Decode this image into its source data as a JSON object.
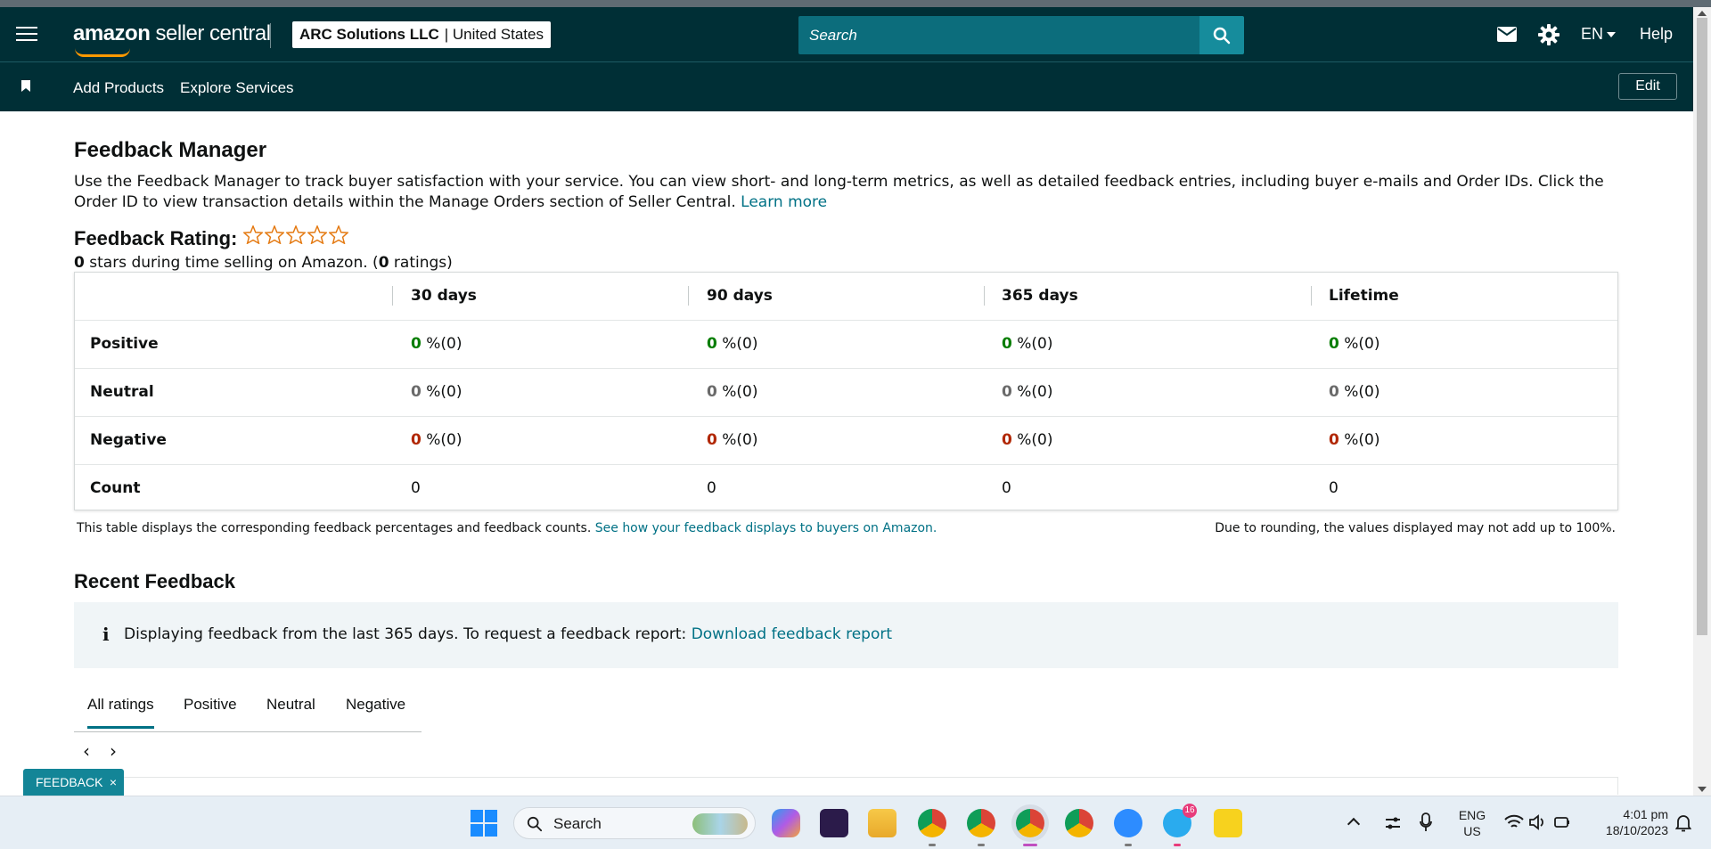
{
  "header": {
    "brand": "amazon",
    "brand_suffix": "seller central",
    "account_name": "ARC Solutions LLC",
    "account_region": "| United States",
    "search_placeholder": "Search",
    "language": "EN",
    "help_label": "Help"
  },
  "subnav": {
    "links": [
      "Add Products",
      "Explore Services"
    ],
    "edit_label": "Edit"
  },
  "page": {
    "title": "Feedback Manager",
    "intro": "Use the Feedback Manager to track buyer satisfaction with your service. You can view short- and long-term metrics, as well as detailed feedback entries, including buyer e-mails and Order IDs. Click the Order ID to view transaction details within the Manage Orders section of Seller Central.",
    "learn_more": "Learn more",
    "rating_label": "Feedback Rating:",
    "rating_stars": 0,
    "rating_max": 5,
    "rating_sub_stars": "0",
    "rating_sub_mid": " stars during time selling on Amazon. (",
    "rating_sub_count": "0",
    "rating_sub_end": " ratings)"
  },
  "table": {
    "headers": [
      "30 days",
      "90 days",
      "365 days",
      "Lifetime"
    ],
    "rows": [
      {
        "label": "Positive",
        "kind": "pos",
        "values": [
          "0",
          "0",
          "0",
          "0"
        ],
        "suffix": " %(0)"
      },
      {
        "label": "Neutral",
        "kind": "neu",
        "values": [
          "0",
          "0",
          "0",
          "0"
        ],
        "suffix": " %(0)"
      },
      {
        "label": "Negative",
        "kind": "neg",
        "values": [
          "0",
          "0",
          "0",
          "0"
        ],
        "suffix": " %(0)"
      },
      {
        "label": "Count",
        "kind": "count",
        "values": [
          "0",
          "0",
          "0",
          "0"
        ],
        "suffix": ""
      }
    ],
    "note": "This table displays the corresponding feedback percentages and feedback counts.",
    "note_link": "See how your feedback displays to buyers on Amazon.",
    "rounding_note": "Due to rounding, the values displayed may not add up to 100%."
  },
  "recent": {
    "title": "Recent Feedback",
    "info_text": "Displaying feedback from the last 365 days. To request a feedback report:",
    "info_link": "Download feedback report",
    "tabs": [
      "All ratings",
      "Positive",
      "Neutral",
      "Negative"
    ],
    "active_tab": "All ratings"
  },
  "feedback_tab": {
    "label": "FEEDBACK",
    "close": "×"
  },
  "taskbar": {
    "search_label": "Search",
    "lang_line1": "ENG",
    "lang_line2": "US",
    "time": "4:01 pm",
    "date": "18/10/2023",
    "telegram_badge": "16"
  },
  "colors": {
    "header_bg": "#002f36",
    "link": "#007185",
    "positive": "#067d02",
    "neutral": "#6a6a6a",
    "negative": "#b12704",
    "star": "#e47911"
  }
}
